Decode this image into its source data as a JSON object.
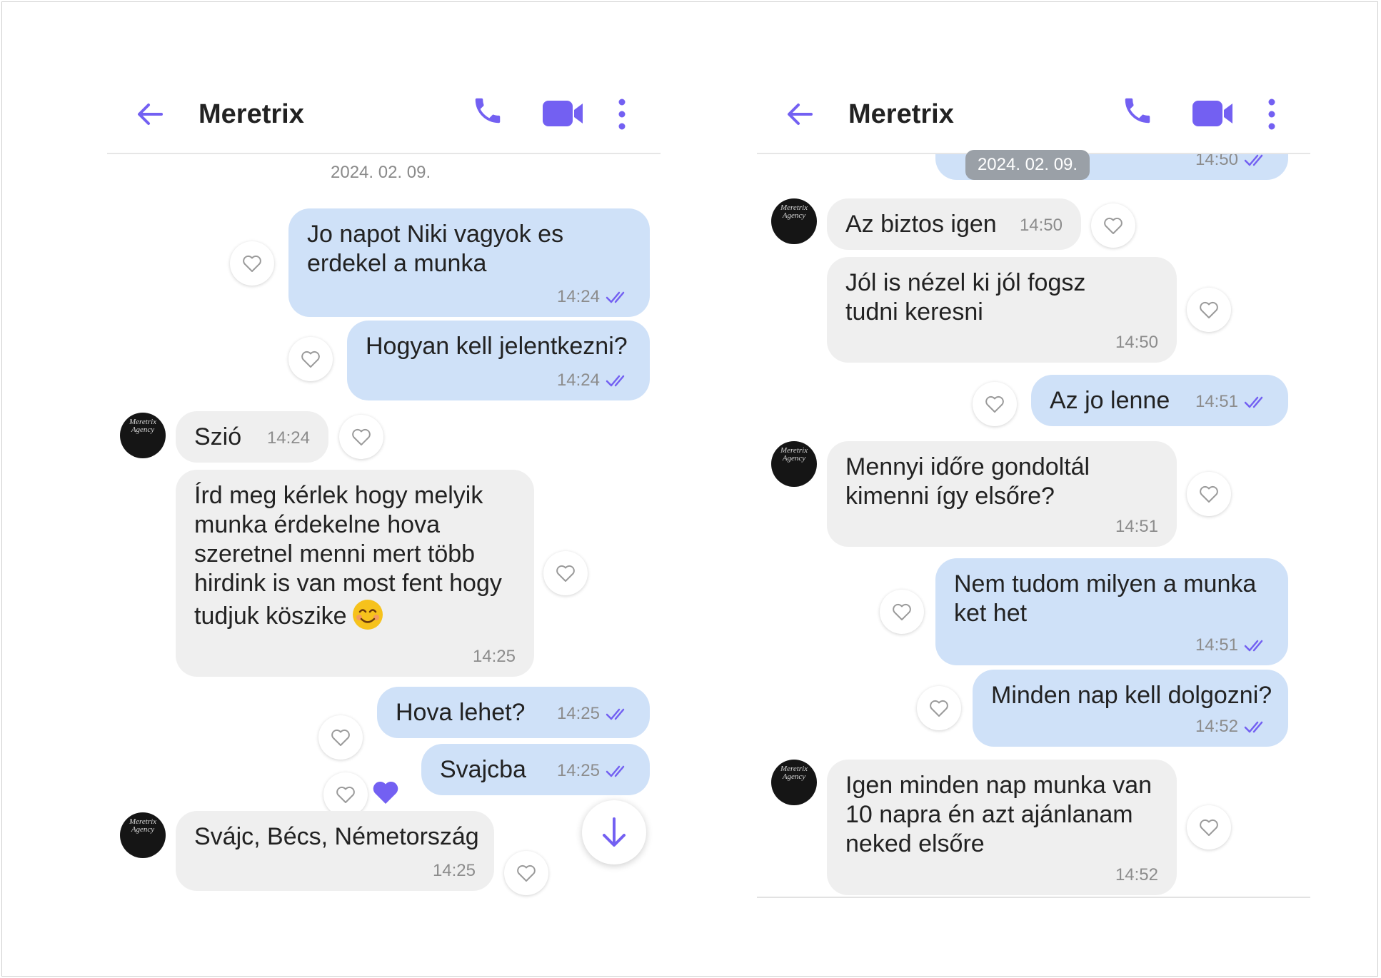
{
  "colors": {
    "accent": "#7360f2",
    "outgoing_bubble": "#cfe1f8",
    "incoming_bubble": "#efefef",
    "muted_text": "#8c8c8c"
  },
  "icons": {
    "back": "arrow-left-icon",
    "call": "phone-icon",
    "video": "video-camera-icon",
    "more": "more-vertical-icon",
    "read": "double-check-icon",
    "like": "heart-outline-icon",
    "liked": "heart-filled-icon",
    "scroll": "arrow-down-icon"
  },
  "left": {
    "header": {
      "title": "Meretrix"
    },
    "date_label": "2024. 02. 09.",
    "messages": [
      {
        "lines": [
          "Jo napot Niki vagyok es",
          "erdekel a munka"
        ],
        "time": "14:24"
      },
      {
        "lines": [
          "Hogyan kell jelentkezni?"
        ],
        "time": "14:24"
      },
      {
        "lines": [
          "Szió"
        ],
        "time": "14:24"
      },
      {
        "lines": [
          "Írd meg kérlek hogy melyik",
          "munka érdekelne hova",
          "szeretnel menni mert több",
          "hirdink is van most fent hogy",
          "tudjuk köszike"
        ],
        "emoji": "smiling-face-emoji",
        "time": "14:25"
      },
      {
        "lines": [
          "Hova lehet?"
        ],
        "time": "14:25"
      },
      {
        "lines": [
          "Svajcba"
        ],
        "time": "14:25"
      },
      {
        "lines": [
          "Svájc, Bécs, Németország"
        ],
        "time": "14:25"
      }
    ]
  },
  "right": {
    "header": {
      "title": "Meretrix"
    },
    "date_label": "2024. 02. 09.",
    "messages": [
      {
        "lines": [],
        "time": "14:50"
      },
      {
        "lines": [
          "Az biztos igen"
        ],
        "time": "14:50"
      },
      {
        "lines": [
          "Jól is nézel ki jól fogsz",
          "tudni keresni"
        ],
        "time": "14:50"
      },
      {
        "lines": [
          "Az jo lenne"
        ],
        "time": "14:51"
      },
      {
        "lines": [
          "Mennyi időre gondoltál",
          "kimenni így elsőre?"
        ],
        "time": "14:51"
      },
      {
        "lines": [
          "Nem tudom milyen a munka",
          "ket het"
        ],
        "time": "14:51"
      },
      {
        "lines": [
          "Minden nap kell dolgozni?"
        ],
        "time": "14:52"
      },
      {
        "lines": [
          "Igen minden nap munka van",
          "10 napra én azt ajánlanam",
          "neked elsőre"
        ],
        "time": "14:52"
      }
    ]
  }
}
